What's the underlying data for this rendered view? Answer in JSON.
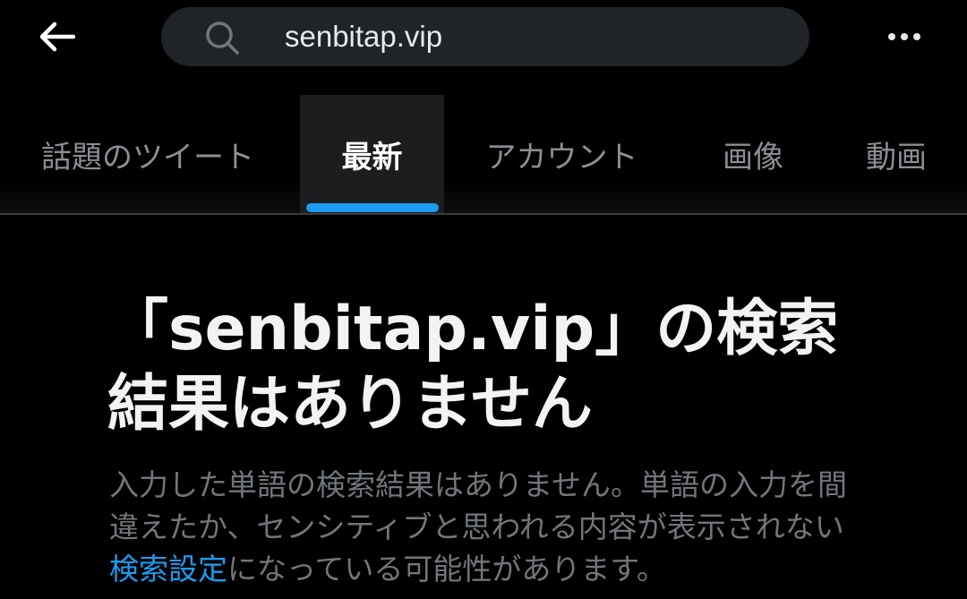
{
  "search": {
    "query": "senbitap.vip",
    "back_icon": "arrow-left-icon",
    "search_icon": "magnifier-icon",
    "more_icon": "more-dots-icon"
  },
  "tabs": [
    {
      "label": "話題のツイート",
      "active": false
    },
    {
      "label": "最新",
      "active": true
    },
    {
      "label": "アカウント",
      "active": false
    },
    {
      "label": "画像",
      "active": false
    },
    {
      "label": "動画",
      "active": false
    }
  ],
  "empty_state": {
    "title": "「senbitap.vip」の検索結果はありません",
    "description_before": "入力した単語の検索結果はありません。単語の入力を間違えたか、センシティブと思われる内容が表示されない",
    "settings_link": "検索設定",
    "description_after": "になっている可能性があります。"
  },
  "colors": {
    "background": "#000000",
    "search_pill": "#202327",
    "accent": "#1d9bf0",
    "primary_text": "#e7e9ea",
    "secondary_text": "#71767b",
    "inactive_tab": "#8b8f94"
  }
}
